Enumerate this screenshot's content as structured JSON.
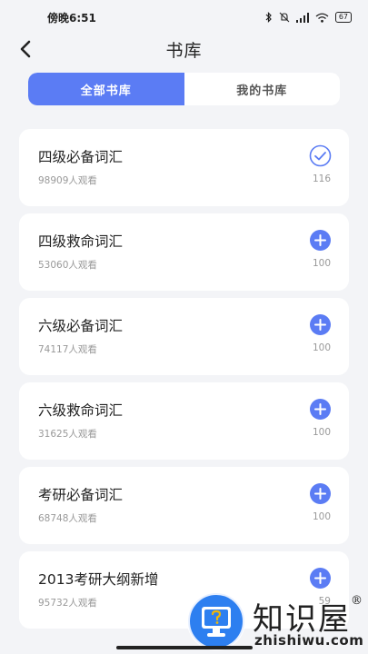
{
  "status_bar": {
    "time": "傍晚6:51",
    "battery": "67",
    "icons": [
      "bluetooth-icon",
      "mute-icon",
      "signal-icon",
      "wifi-icon",
      "battery-icon"
    ]
  },
  "header": {
    "title": "书库",
    "back_icon": "chevron-left-icon"
  },
  "tabs": [
    {
      "label": "全部书库",
      "active": true
    },
    {
      "label": "我的书库",
      "active": false
    }
  ],
  "books": [
    {
      "title": "四级必备词汇",
      "views": "98909人观看",
      "count": "116",
      "action": "check"
    },
    {
      "title": "四级救命词汇",
      "views": "53060人观看",
      "count": "100",
      "action": "add"
    },
    {
      "title": "六级必备词汇",
      "views": "74117人观看",
      "count": "100",
      "action": "add"
    },
    {
      "title": "六级救命词汇",
      "views": "31625人观看",
      "count": "100",
      "action": "add"
    },
    {
      "title": "考研必备词汇",
      "views": "68748人观看",
      "count": "100",
      "action": "add"
    },
    {
      "title": "2013考研大纲新增",
      "views": "95732人观看",
      "count": "59",
      "action": "add"
    }
  ],
  "watermark": {
    "text": "知识屋",
    "reg": "®",
    "url": "zhishiwu.com"
  },
  "colors": {
    "accent": "#5b7cf4",
    "background": "#f3f4f7"
  }
}
